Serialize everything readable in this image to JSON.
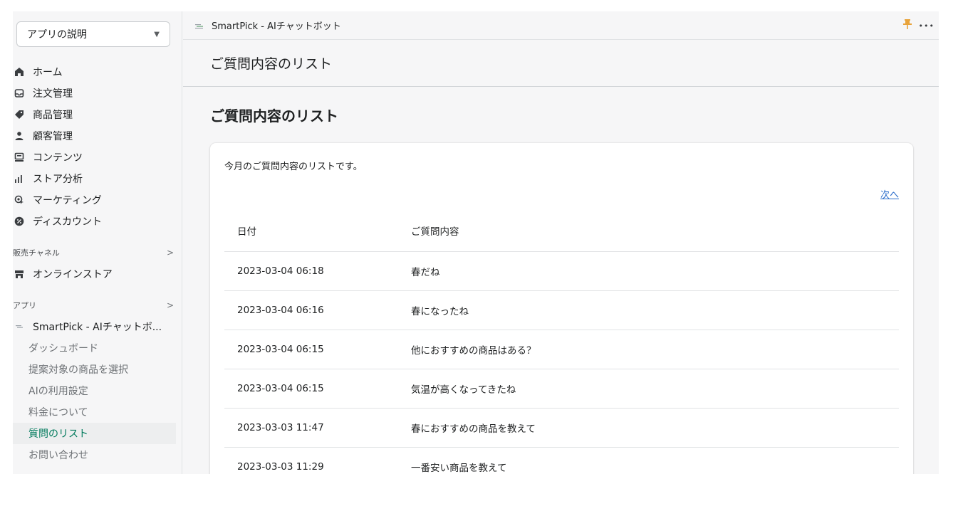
{
  "sidebar": {
    "app_select": "アプリの説明",
    "nav": [
      {
        "label": "ホーム",
        "icon": "home-icon"
      },
      {
        "label": "注文管理",
        "icon": "inbox-icon"
      },
      {
        "label": "商品管理",
        "icon": "tag-icon"
      },
      {
        "label": "顧客管理",
        "icon": "person-icon"
      },
      {
        "label": "コンテンツ",
        "icon": "content-icon"
      },
      {
        "label": "ストア分析",
        "icon": "analytics-icon"
      },
      {
        "label": "マーケティング",
        "icon": "marketing-icon"
      },
      {
        "label": "ディスカウント",
        "icon": "discount-icon"
      }
    ],
    "sales_channel_heading": "販売チャネル",
    "online_store": "オンラインストア",
    "apps_heading": "アプリ",
    "app_name": "SmartPick - AIチャットボ...",
    "app_subitems": [
      "ダッシュボード",
      "提案対象の商品を選択",
      "AIの利用設定",
      "料金について",
      "質問のリスト",
      "お問い合わせ"
    ],
    "active_subitem": "質問のリスト"
  },
  "topbar": {
    "title": "SmartPick - AIチャットボット",
    "more": "•••"
  },
  "page": {
    "header": "ご質問内容のリスト",
    "content_title": "ご質問内容のリスト",
    "description": "今月のご質問内容のリストです。",
    "next_link": "次へ"
  },
  "table": {
    "columns": [
      "日付",
      "ご質問内容"
    ],
    "rows": [
      [
        "2023-03-04 06:18",
        "春だね"
      ],
      [
        "2023-03-04 06:16",
        "春になったね"
      ],
      [
        "2023-03-04 06:15",
        "他におすすめの商品はある？"
      ],
      [
        "2023-03-04 06:15",
        "気温が高くなってきたね"
      ],
      [
        "2023-03-03 11:47",
        "春におすすめの商品を教えて"
      ],
      [
        "2023-03-03 11:29",
        "一番安い商品を教えて"
      ]
    ]
  },
  "colors": {
    "active_text": "#007a5c",
    "link": "#2c6ecb",
    "pin": "#e8a33a",
    "background": "#f6f6f7"
  }
}
